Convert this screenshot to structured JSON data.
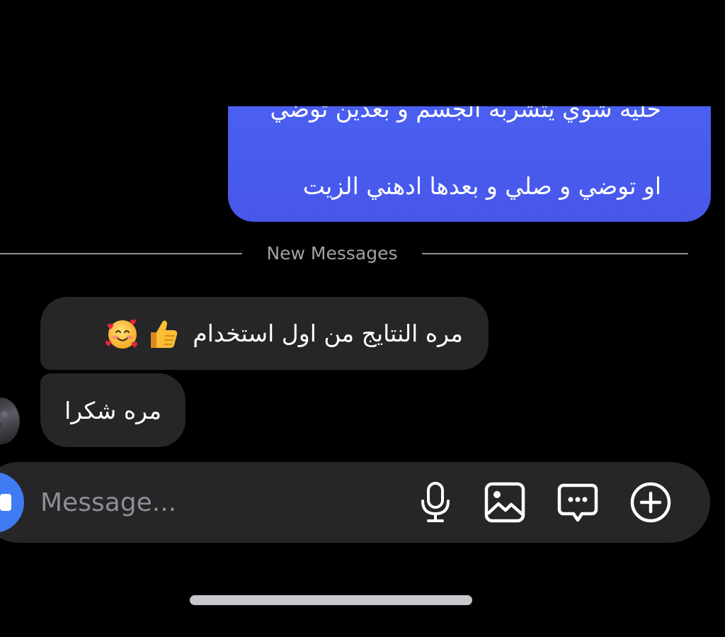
{
  "sent_message": {
    "line_partial": "خليه شوي يتشربه الجسم و بعدين توضي",
    "line_full": "او توضي و صلي و بعدها ادهني الزيت",
    "bubble_color": "#4a5ff0"
  },
  "divider": {
    "label": "New Messages"
  },
  "received_messages": [
    {
      "text": "مره النتايج من اول استخدام",
      "emojis": [
        "thumbs-up-emoji",
        "smiling-face-with-hearts-emoji"
      ]
    },
    {
      "text": "مره شكرا"
    }
  ],
  "composer": {
    "placeholder": "Message...",
    "icons": [
      "camera-icon",
      "microphone-icon",
      "gallery-icon",
      "sticker-icon",
      "add-icon"
    ],
    "accent_color": "#3f7bf3"
  },
  "colors": {
    "background": "#000000",
    "received_bubble": "#262628",
    "placeholder": "#8e8e93"
  }
}
